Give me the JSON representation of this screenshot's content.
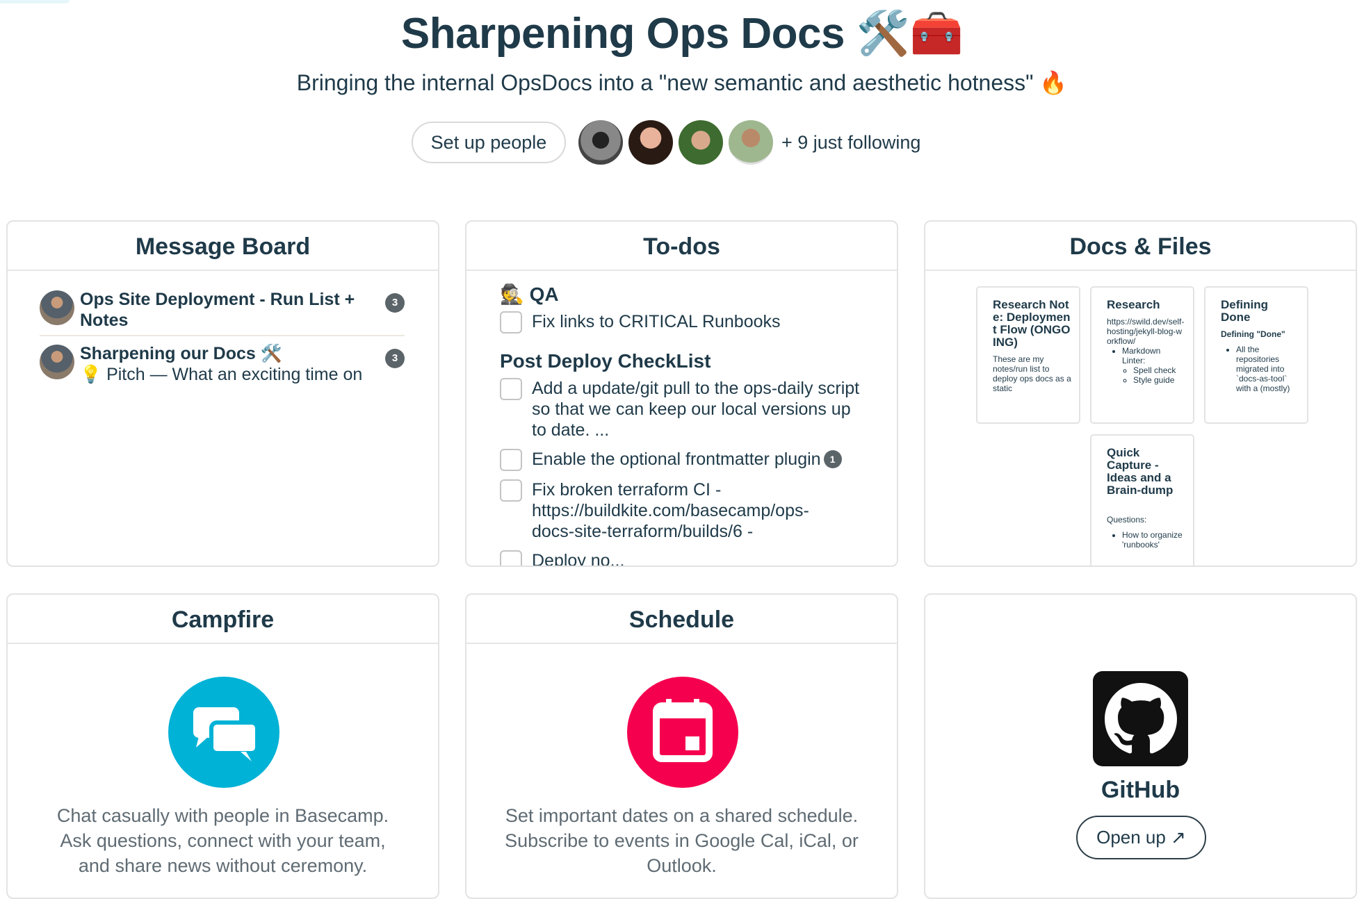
{
  "header": {
    "title": "Sharpening Ops Docs",
    "title_emoji": "🛠️🧰",
    "subtitle": "Bringing the internal OpsDocs into a \"new semantic and aesthetic hotness\"",
    "subtitle_emoji": "🔥"
  },
  "people": {
    "setup_label": "Set up people",
    "following": "+ 9 just following",
    "avatars": [
      "person-1",
      "person-2",
      "person-3",
      "person-4"
    ]
  },
  "message_board": {
    "title": "Message Board",
    "items": [
      {
        "title": "Ops Site Deployment - Run List + Notes",
        "snippet": "",
        "count": "3"
      },
      {
        "title": "Sharpening our Docs 🛠️",
        "snippet": "💡 Pitch — What an exciting time on",
        "count": "3"
      }
    ]
  },
  "todos": {
    "title": "To-dos",
    "groups": [
      {
        "title": "🕵️ QA",
        "items": [
          {
            "text": "Fix links to CRITICAL Runbooks"
          }
        ]
      },
      {
        "title": "Post Deploy CheckList",
        "items": [
          {
            "text": "Add a update/git pull to the ops-daily script so that we can keep our local versions up to date. ..."
          },
          {
            "text": "Enable the optional frontmatter plugin",
            "count": "1"
          },
          {
            "text": "Fix broken terraform CI - https://buildkite.com/basecamp/ops-docs-site-terraform/builds/6 -"
          },
          {
            "text": "Deploy no..."
          }
        ]
      }
    ]
  },
  "docs": {
    "title": "Docs & Files",
    "items": [
      {
        "title": "Research Note: Deployment Flow (ONGOING)",
        "body": "These are my notes/run list to deploy ops docs as a static"
      },
      {
        "title": "Research",
        "body": "https://swild.dev/self-hosting/jekyll-blog-workflow/",
        "bullets": [
          "Markdown Linter:"
        ],
        "sub": [
          "Spell check",
          "Style guide"
        ]
      },
      {
        "title": "Defining Done",
        "sub_title": "Defining \"Done\"",
        "bullets": [
          "All the repositories migrated into `docs-as-tool` with a (mostly)"
        ]
      },
      {
        "title": "Quick Capture - Ideas and a Brain-dump",
        "body": "Questions:",
        "bullets": [
          "How to organize 'runbooks'"
        ]
      }
    ]
  },
  "campfire": {
    "title": "Campfire",
    "description": "Chat casually with people in Basecamp. Ask questions, connect with your team, and share news without ceremony.",
    "color": "#00b2d6"
  },
  "schedule": {
    "title": "Schedule",
    "description": "Set important dates on a shared schedule. Subscribe to events in Google Cal, iCal, or Outlook.",
    "color": "#f5004f"
  },
  "github": {
    "name": "GitHub",
    "button": "Open up ↗"
  }
}
